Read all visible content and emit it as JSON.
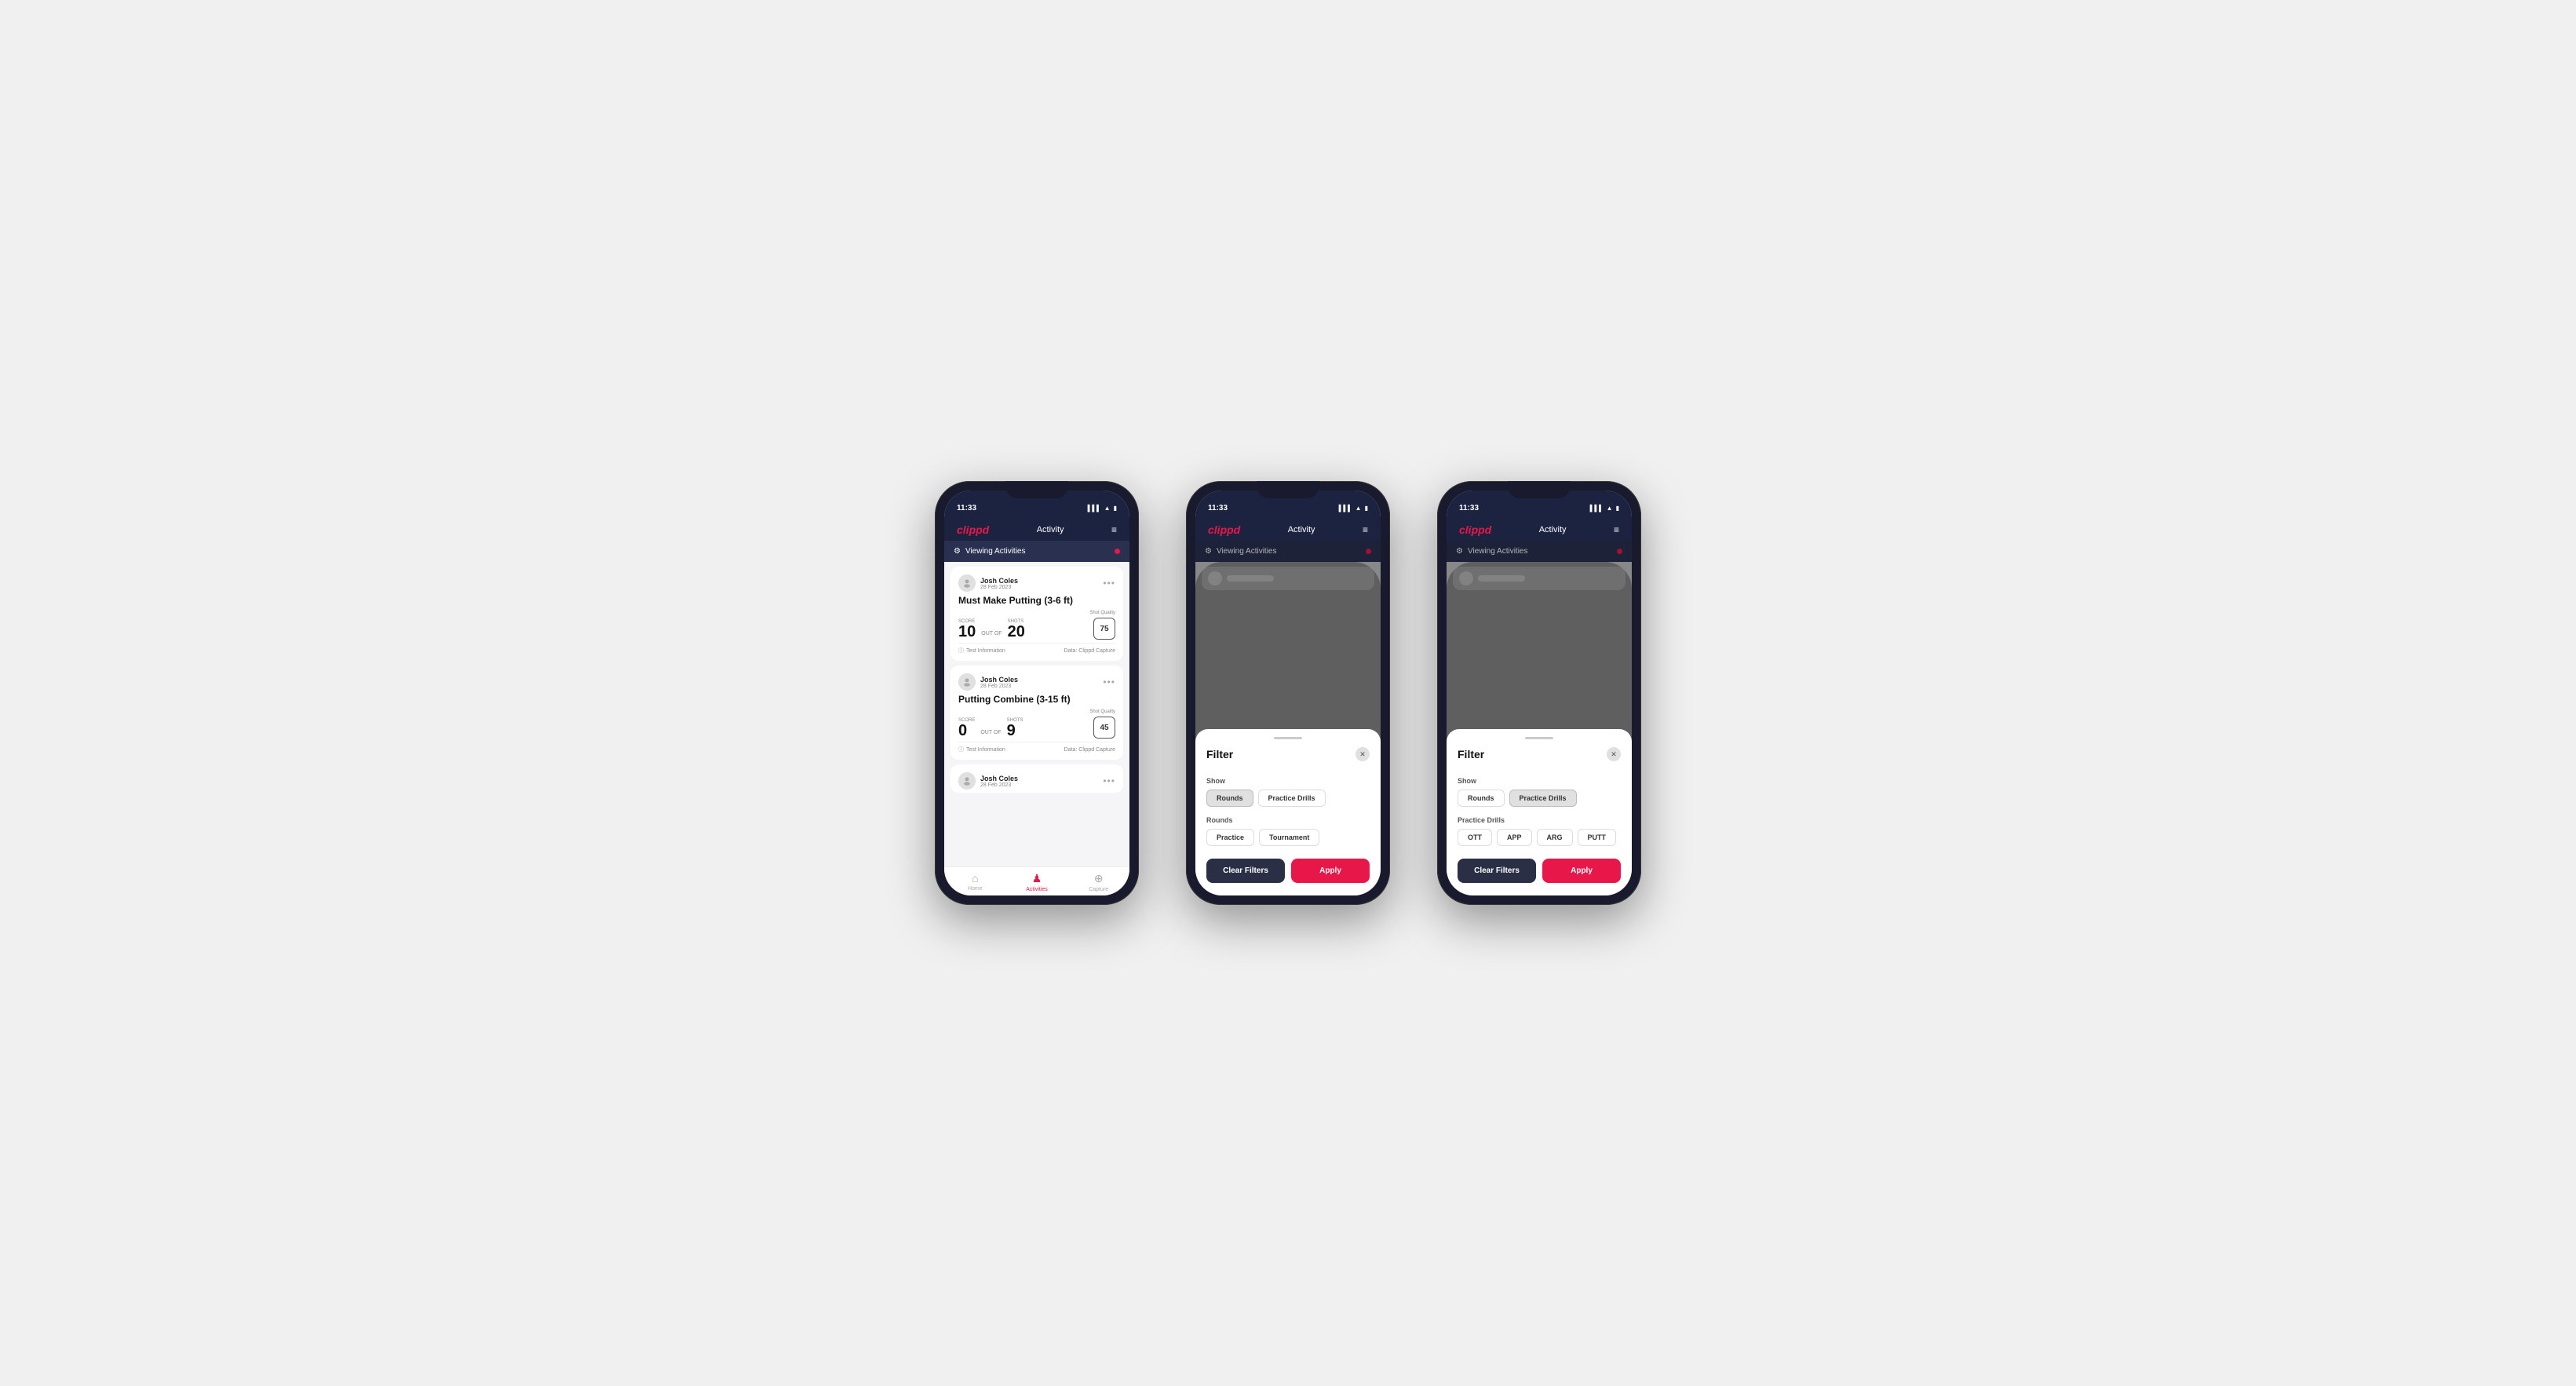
{
  "app": {
    "name": "clippd",
    "title": "Activity",
    "time": "11:33"
  },
  "phone1": {
    "viewing_bar": "Viewing Activities",
    "activities": [
      {
        "user": "Josh Coles",
        "date": "28 Feb 2023",
        "title": "Must Make Putting (3-6 ft)",
        "score_label": "Score",
        "score_value": "10",
        "out_of_label": "OUT OF",
        "shots_label": "Shots",
        "shots_value": "20",
        "shot_quality_label": "Shot Quality",
        "shot_quality_value": "75",
        "info_label": "Test Information",
        "data_label": "Data: Clippd Capture"
      },
      {
        "user": "Josh Coles",
        "date": "28 Feb 2023",
        "title": "Putting Combine (3-15 ft)",
        "score_label": "Score",
        "score_value": "0",
        "out_of_label": "OUT OF",
        "shots_label": "Shots",
        "shots_value": "9",
        "shot_quality_label": "Shot Quality",
        "shot_quality_value": "45",
        "info_label": "Test Information",
        "data_label": "Data: Clippd Capture"
      },
      {
        "user": "Josh Coles",
        "date": "28 Feb 2023",
        "title": "",
        "score_label": "",
        "score_value": "",
        "out_of_label": "",
        "shots_label": "",
        "shots_value": "",
        "shot_quality_label": "",
        "shot_quality_value": "",
        "info_label": "",
        "data_label": ""
      }
    ],
    "tabs": {
      "home_label": "Home",
      "activities_label": "Activities",
      "capture_label": "Capture"
    }
  },
  "phone2": {
    "viewing_bar": "Viewing Activities",
    "filter": {
      "title": "Filter",
      "show_label": "Show",
      "rounds_btn": "Rounds",
      "practice_drills_btn": "Practice Drills",
      "rounds_section_label": "Rounds",
      "practice_btn": "Practice",
      "tournament_btn": "Tournament",
      "clear_label": "Clear Filters",
      "apply_label": "Apply"
    }
  },
  "phone3": {
    "viewing_bar": "Viewing Activities",
    "filter": {
      "title": "Filter",
      "show_label": "Show",
      "rounds_btn": "Rounds",
      "practice_drills_btn": "Practice Drills",
      "practice_drills_section_label": "Practice Drills",
      "ott_btn": "OTT",
      "app_btn": "APP",
      "arg_btn": "ARG",
      "putt_btn": "PUTT",
      "clear_label": "Clear Filters",
      "apply_label": "Apply"
    }
  }
}
